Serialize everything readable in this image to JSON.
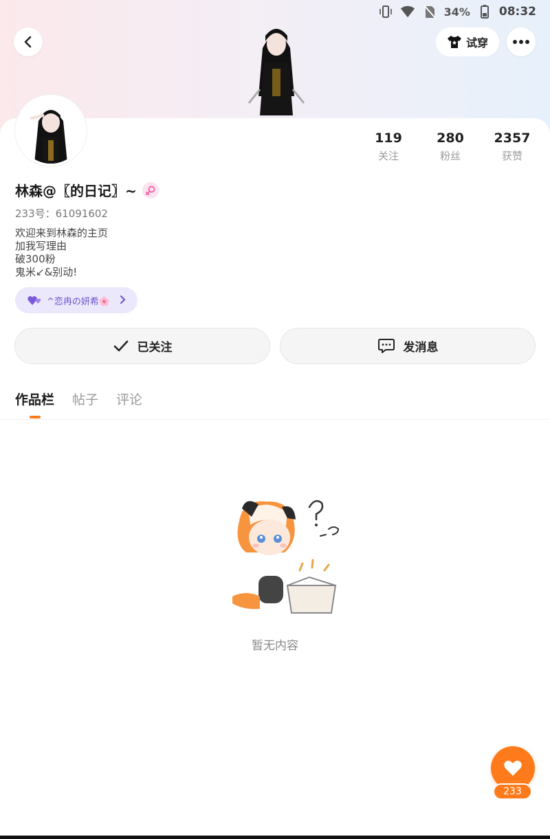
{
  "status_bar": {
    "battery": "34%",
    "time": "08:32",
    "icons": [
      "vibrate-icon",
      "wifi-icon",
      "no-sim-icon",
      "battery-icon"
    ]
  },
  "header": {
    "tryon_label": "试穿",
    "icons": [
      "back-icon",
      "shirt-icon",
      "more-icon"
    ]
  },
  "profile": {
    "name": "林森@〖的日记〗~",
    "gender": "female",
    "uid_label": "233号：61091602",
    "bio": [
      "欢迎来到林森的主页",
      "加我写理由",
      "破300粉",
      "鬼米↙&别动!"
    ],
    "tag": "^恋冉の妍希🌸",
    "stats": [
      {
        "value": "119",
        "label": "关注"
      },
      {
        "value": "280",
        "label": "粉丝"
      },
      {
        "value": "2357",
        "label": "获赞"
      }
    ]
  },
  "actions": {
    "follow_label": "已关注",
    "message_label": "发消息"
  },
  "tabs": [
    "作品栏",
    "帖子",
    "评论"
  ],
  "active_tab": "作品栏",
  "empty_text": "暂无内容",
  "fab": {
    "count": "233"
  },
  "colors": {
    "accent": "#ff7a1a",
    "tag_text": "#6a53c9",
    "tag_bg": "#ece8fb"
  }
}
